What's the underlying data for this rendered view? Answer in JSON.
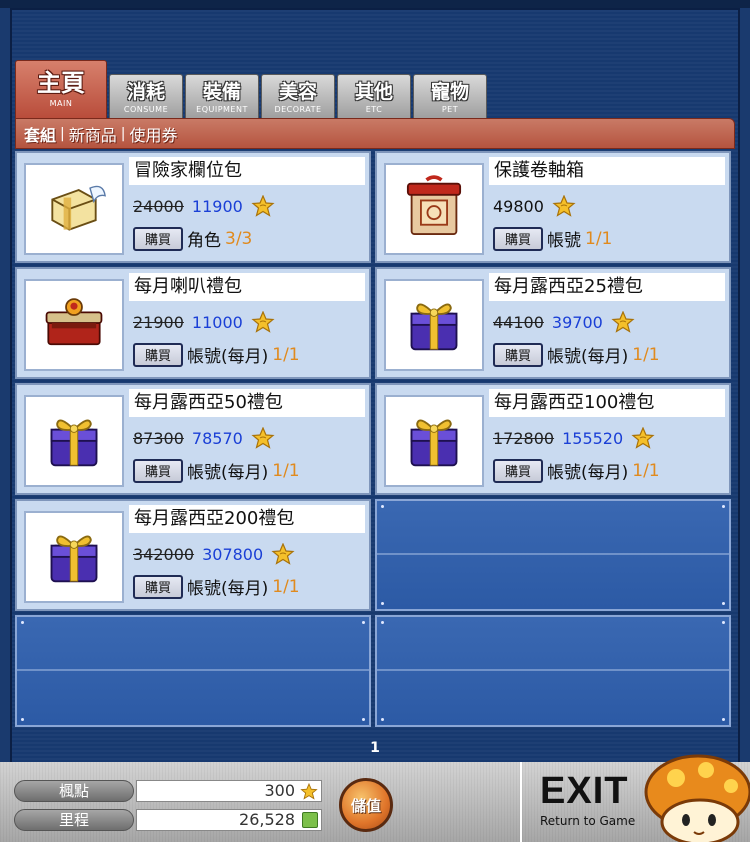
{
  "tabs": [
    {
      "label": "主頁",
      "sub": "MAIN",
      "active": true
    },
    {
      "label": "消耗",
      "sub": "CONSUME"
    },
    {
      "label": "裝備",
      "sub": "EQUIPMENT"
    },
    {
      "label": "美容",
      "sub": "DECORATE"
    },
    {
      "label": "其他",
      "sub": "ETC"
    },
    {
      "label": "寵物",
      "sub": "PET"
    }
  ],
  "subnav": {
    "items": [
      "套組",
      "新商品",
      "使用券"
    ],
    "separator": "|"
  },
  "items": [
    {
      "name": "冒險家欄位包",
      "old_price": "24000",
      "price": "11900",
      "buy_label": "購買",
      "target": "角色",
      "limit": "3/3",
      "icon": "winged-box-icon"
    },
    {
      "name": "保護卷軸箱",
      "old_price": "",
      "price": "49800",
      "buy_label": "購買",
      "target": "帳號",
      "limit": "1/1",
      "icon": "red-scroll-box-icon"
    },
    {
      "name": "每月喇叭禮包",
      "old_price": "21900",
      "price": "11000",
      "buy_label": "購買",
      "target": "帳號(每月)",
      "limit": "1/1",
      "icon": "red-chest-icon"
    },
    {
      "name": "每月露西亞25禮包",
      "old_price": "44100",
      "price": "39700",
      "buy_label": "購買",
      "target": "帳號(每月)",
      "limit": "1/1",
      "icon": "purple-gift-icon"
    },
    {
      "name": "每月露西亞50禮包",
      "old_price": "87300",
      "price": "78570",
      "buy_label": "購買",
      "target": "帳號(每月)",
      "limit": "1/1",
      "icon": "purple-gift-icon"
    },
    {
      "name": "每月露西亞100禮包",
      "old_price": "172800",
      "price": "155520",
      "buy_label": "購買",
      "target": "帳號(每月)",
      "limit": "1/1",
      "icon": "purple-gift-icon"
    },
    {
      "name": "每月露西亞200禮包",
      "old_price": "342000",
      "price": "307800",
      "buy_label": "購買",
      "target": "帳號(每月)",
      "limit": "1/1",
      "icon": "purple-gift-icon"
    }
  ],
  "pagination": {
    "current": "1"
  },
  "balance": {
    "points_label": "楓點",
    "points_value": "300",
    "mileage_label": "里程",
    "mileage_value": "26,528"
  },
  "charge_label": "儲值",
  "exit": {
    "title": "EXIT",
    "subtitle": "Return to Game"
  },
  "colors": {
    "accent": "#b5543f",
    "price_blue": "#1a3fd6",
    "limit_orange": "#e08a1e",
    "panel_bg": "#c9daf0"
  }
}
